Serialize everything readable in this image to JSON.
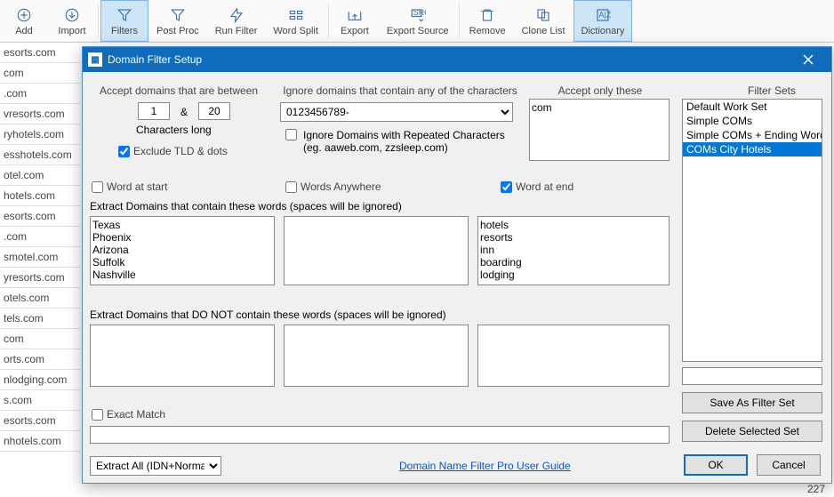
{
  "ribbon": {
    "add": "Add",
    "import": "Import",
    "filters": "Filters",
    "postproc": "Post Proc",
    "runfilter": "Run Filter",
    "wordsplit": "Word Split",
    "export": "Export",
    "exportsource": "Export Source",
    "remove": "Remove",
    "clonelist": "Clone List",
    "dictionary": "Dictionary"
  },
  "bg_list": [
    "esorts.com",
    "com",
    ".com",
    "vresorts.com",
    "ryhotels.com",
    "esshotels.com",
    "otel.com",
    "hotels.com",
    "esorts.com",
    ".com",
    "smotel.com",
    "yresorts.com",
    "otels.com",
    "tels.com",
    "com",
    "orts.com",
    "nlodging.com",
    "s.com",
    "esorts.com",
    "nhotels.com"
  ],
  "dialog": {
    "title": "Domain Filter Setup",
    "sections": {
      "between": "Accept domains that are between",
      "ignore": "Ignore domains that contain any of the characters",
      "accept": "Accept only these TLDs/ccTLDs",
      "sets": "Filter Sets"
    },
    "between": {
      "min": "1",
      "amp": "&",
      "max": "20",
      "chars_long": "Characters long",
      "exclude_tld": "Exclude TLD & dots"
    },
    "ignore": {
      "chars": "0123456789-",
      "repeated_label": "Ignore Domains with Repeated Characters (eg. aaweb.com, zzsleep.com)"
    },
    "accept_tlds": "com",
    "filter_sets": [
      "Default Work Set",
      "Simple COMs",
      "Simple COMs + Ending Words",
      "COMs City Hotels"
    ],
    "selected_set_index": 3,
    "word_checks": {
      "start": "Word at start",
      "anywhere": "Words Anywhere",
      "end": "Word at end"
    },
    "extract_label": "Extract Domains that contain these words (spaces will be ignored)",
    "extract_not_label": "Extract Domains that DO NOT contain these words (spaces will be ignored)",
    "ta1_text": "Texas\nPhoenix\nArizona\nSuffolk\nNashville",
    "ta2_text": "",
    "ta3_text": "hotels\nresorts\ninn\nboarding\nlodging",
    "tb1_text": "",
    "tb2_text": "",
    "tb3_text": "",
    "exact_match": "Exact Match",
    "sets_name": "",
    "save_set": "Save As Filter Set",
    "delete_set": "Delete Selected Set",
    "extract_mode": "Extract All (IDN+Normal)",
    "user_guide": "Domain Name Filter Pro User Guide",
    "ok": "OK",
    "cancel": "Cancel"
  },
  "footer_count": "227"
}
